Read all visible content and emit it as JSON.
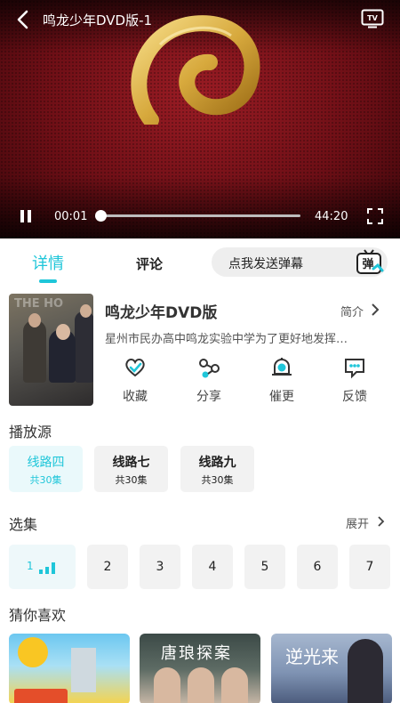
{
  "player": {
    "title": "鸣龙少年DVD版-1",
    "current_time": "00:01",
    "total_time": "44:20",
    "progress": 0.0004
  },
  "tabs": {
    "detail": "详情",
    "comments": "评论"
  },
  "danmaku": {
    "placeholder": "点我发送弹幕",
    "icon_label": "弹"
  },
  "show": {
    "title": "鸣龙少年DVD版",
    "intro_link": "简介",
    "description": "星州市民办高中鸣龙实验中学为了更好地发挥…",
    "poster_text": "THE HO"
  },
  "actions": [
    {
      "label": "收藏",
      "icon": "heart-icon"
    },
    {
      "label": "分享",
      "icon": "share-icon"
    },
    {
      "label": "催更",
      "icon": "bell-icon"
    },
    {
      "label": "反馈",
      "icon": "feedback-icon"
    }
  ],
  "sources": {
    "title": "播放源",
    "items": [
      {
        "name": "线路四",
        "count": "共30集",
        "active": true
      },
      {
        "name": "线路七",
        "count": "共30集",
        "active": false
      },
      {
        "name": "线路九",
        "count": "共30集",
        "active": false
      }
    ]
  },
  "episodes": {
    "title": "选集",
    "expand": "展开",
    "items": [
      "1",
      "2",
      "3",
      "4",
      "5",
      "6",
      "7"
    ],
    "active_index": 0
  },
  "recommend": {
    "title": "猜你喜欢",
    "items": [
      {
        "overlay_text": ""
      },
      {
        "overlay_text": "唐琅探案"
      },
      {
        "overlay_text": "逆光来"
      }
    ]
  },
  "colors": {
    "accent": "#1fc6d9",
    "player_bg": "#7a111a"
  }
}
